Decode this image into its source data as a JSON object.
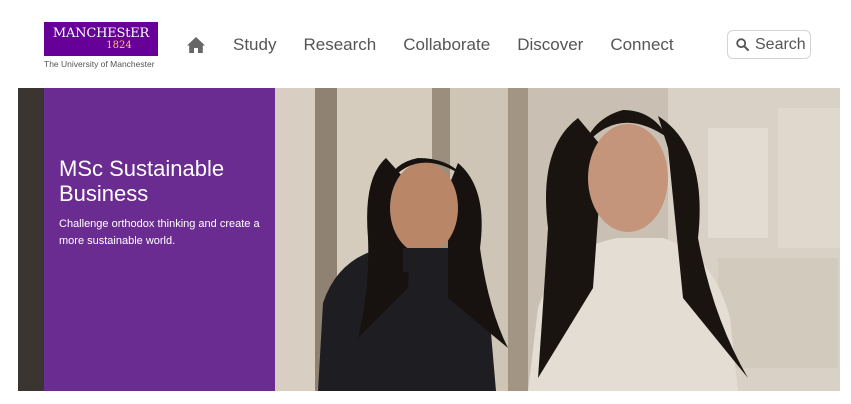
{
  "header": {
    "logo": {
      "wordmark": "MANCHEStER",
      "year": "1824",
      "caption": "The University of Manchester"
    },
    "home_icon": "home-icon",
    "nav": [
      {
        "label": "Study"
      },
      {
        "label": "Research"
      },
      {
        "label": "Collaborate"
      },
      {
        "label": "Discover"
      },
      {
        "label": "Connect"
      }
    ],
    "search": {
      "label": "Search",
      "icon": "search-icon"
    }
  },
  "hero": {
    "title": "MSc Sustainable Business",
    "description": "Challenge orthodox thinking and create a more sustainable world.",
    "image_description": "two-students-photo"
  },
  "colors": {
    "brand_purple": "#660099",
    "panel_purple": "#6b2c91",
    "brand_gold": "#ffcc33",
    "nav_text": "#555555"
  }
}
